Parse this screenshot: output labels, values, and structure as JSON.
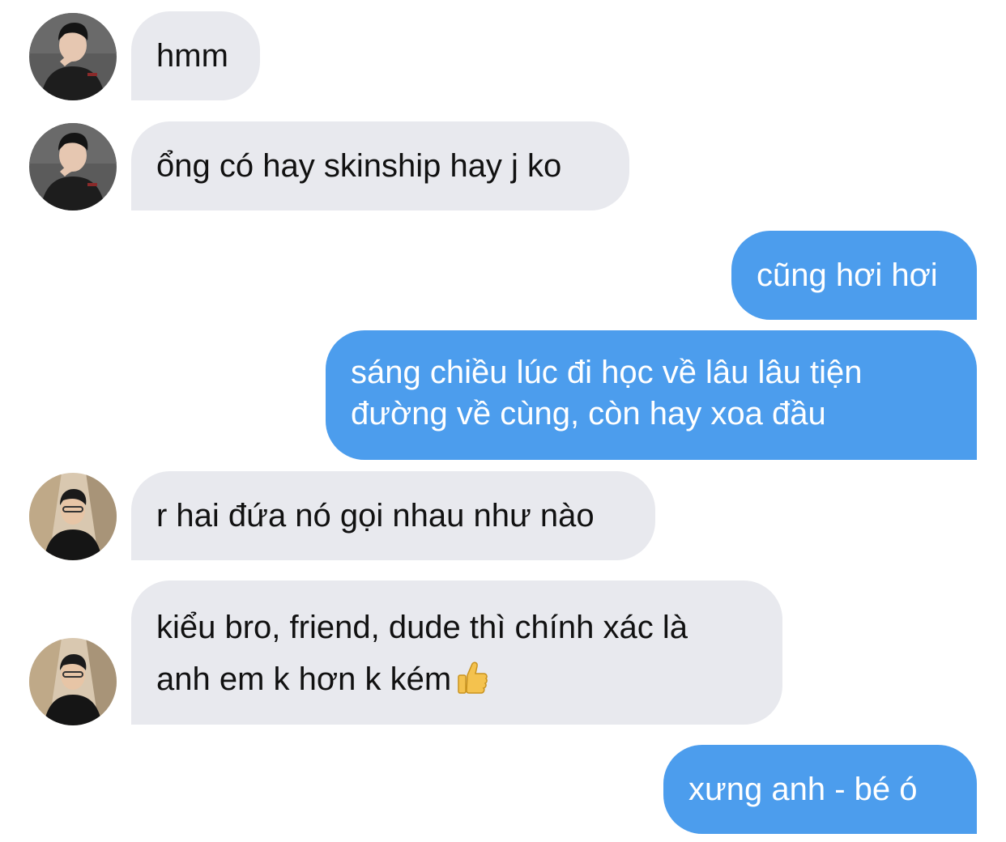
{
  "messages": [
    {
      "sender": "user-a",
      "side": "incoming",
      "text": "hmm"
    },
    {
      "sender": "user-a",
      "side": "incoming",
      "text": "ổng có hay skinship hay j ko"
    },
    {
      "sender": "me",
      "side": "outgoing",
      "text": "cũng hơi hơi"
    },
    {
      "sender": "me",
      "side": "outgoing",
      "lines": [
        "sáng chiều lúc đi học về lâu lâu tiện",
        "đường về cùng, còn hay xoa đầu"
      ]
    },
    {
      "sender": "user-b",
      "side": "incoming",
      "text": "r hai đứa nó gọi nhau như nào"
    },
    {
      "sender": "user-b",
      "side": "incoming",
      "lines": [
        "kiểu bro, friend, dude thì chính xác là",
        "anh em k hơn k kém"
      ],
      "emoji": "thumbs-up-icon"
    },
    {
      "sender": "me",
      "side": "outgoing",
      "text": "xưng anh - bé ó"
    }
  ],
  "colors": {
    "incoming_bubble": "#e8e9ee",
    "outgoing_bubble": "#4c9ded",
    "incoming_text": "#111111",
    "outgoing_text": "#ffffff"
  }
}
